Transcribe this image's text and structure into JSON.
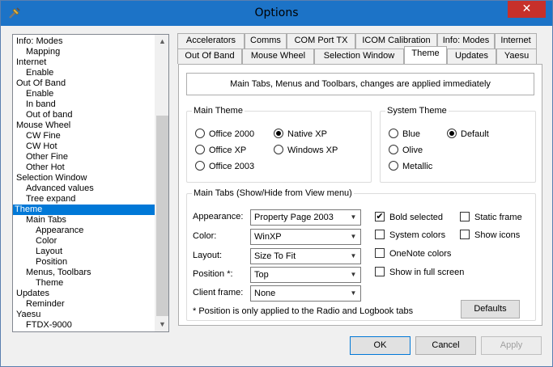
{
  "window": {
    "title": "Options",
    "close_glyph": "✕"
  },
  "tree": {
    "items": [
      {
        "label": "Info: Modes",
        "level": 0
      },
      {
        "label": "Mapping",
        "level": 1
      },
      {
        "label": "Internet",
        "level": 0
      },
      {
        "label": "Enable",
        "level": 1
      },
      {
        "label": "Out Of Band",
        "level": 0
      },
      {
        "label": "Enable",
        "level": 1
      },
      {
        "label": "In band",
        "level": 1
      },
      {
        "label": "Out of band",
        "level": 1
      },
      {
        "label": "Mouse Wheel",
        "level": 0
      },
      {
        "label": "CW Fine",
        "level": 1
      },
      {
        "label": "CW Hot",
        "level": 1
      },
      {
        "label": "Other Fine",
        "level": 1
      },
      {
        "label": "Other Hot",
        "level": 1
      },
      {
        "label": "Selection Window",
        "level": 0
      },
      {
        "label": "Advanced values",
        "level": 1
      },
      {
        "label": "Tree expand",
        "level": 1
      },
      {
        "label": "Theme",
        "level": 0,
        "selected": true
      },
      {
        "label": "Main Tabs",
        "level": 1
      },
      {
        "label": "Appearance",
        "level": 2
      },
      {
        "label": "Color",
        "level": 2
      },
      {
        "label": "Layout",
        "level": 2
      },
      {
        "label": "Position",
        "level": 2
      },
      {
        "label": "Menus, Toolbars",
        "level": 1
      },
      {
        "label": "Theme",
        "level": 2
      },
      {
        "label": "Updates",
        "level": 0
      },
      {
        "label": "Reminder",
        "level": 1
      },
      {
        "label": "Yaesu",
        "level": 0
      },
      {
        "label": "FTDX-9000",
        "level": 1
      }
    ]
  },
  "tabs": {
    "row1": [
      "Accelerators",
      "Comms",
      "COM Port TX",
      "ICOM Calibration",
      "Info: Modes",
      "Internet"
    ],
    "row2": [
      "Out Of Band",
      "Mouse Wheel",
      "Selection Window",
      "Theme",
      "Updates",
      "Yaesu"
    ],
    "active": "Theme"
  },
  "panel": {
    "info": "Main Tabs, Menus and Toolbars, changes are applied immediately",
    "main_theme": {
      "title": "Main Theme",
      "options": [
        "Office 2000",
        "Office XP",
        "Office 2003",
        "Native XP",
        "Windows XP"
      ],
      "selected": "Native XP"
    },
    "system_theme": {
      "title": "System Theme",
      "options": [
        "Blue",
        "Olive",
        "Metallic",
        "Default"
      ],
      "selected": "Default"
    },
    "main_tabs": {
      "title": "Main Tabs (Show/Hide from View menu)",
      "appearance": {
        "label": "Appearance:",
        "value": "Property Page 2003"
      },
      "color": {
        "label": "Color:",
        "value": "WinXP"
      },
      "layout": {
        "label": "Layout:",
        "value": "Size To Fit"
      },
      "position": {
        "label": "Position *:",
        "value": "Top"
      },
      "client_frame": {
        "label": "Client frame:",
        "value": "None"
      },
      "checks": {
        "bold_selected": {
          "label": "Bold selected",
          "checked": true
        },
        "static_frame": {
          "label": "Static frame",
          "checked": false
        },
        "system_colors": {
          "label": "System colors",
          "checked": false
        },
        "show_icons": {
          "label": "Show icons",
          "checked": false
        },
        "onenote_colors": {
          "label": "OneNote colors",
          "checked": false
        },
        "show_full_screen": {
          "label": "Show in full screen",
          "checked": false
        }
      },
      "note": "* Position is only applied to the Radio and Logbook tabs",
      "defaults_label": "Defaults"
    }
  },
  "footer": {
    "ok": "OK",
    "cancel": "Cancel",
    "apply": "Apply"
  },
  "colors": {
    "titlebar": "#1c73c7",
    "close": "#c7302a",
    "selection": "#0078d7"
  }
}
